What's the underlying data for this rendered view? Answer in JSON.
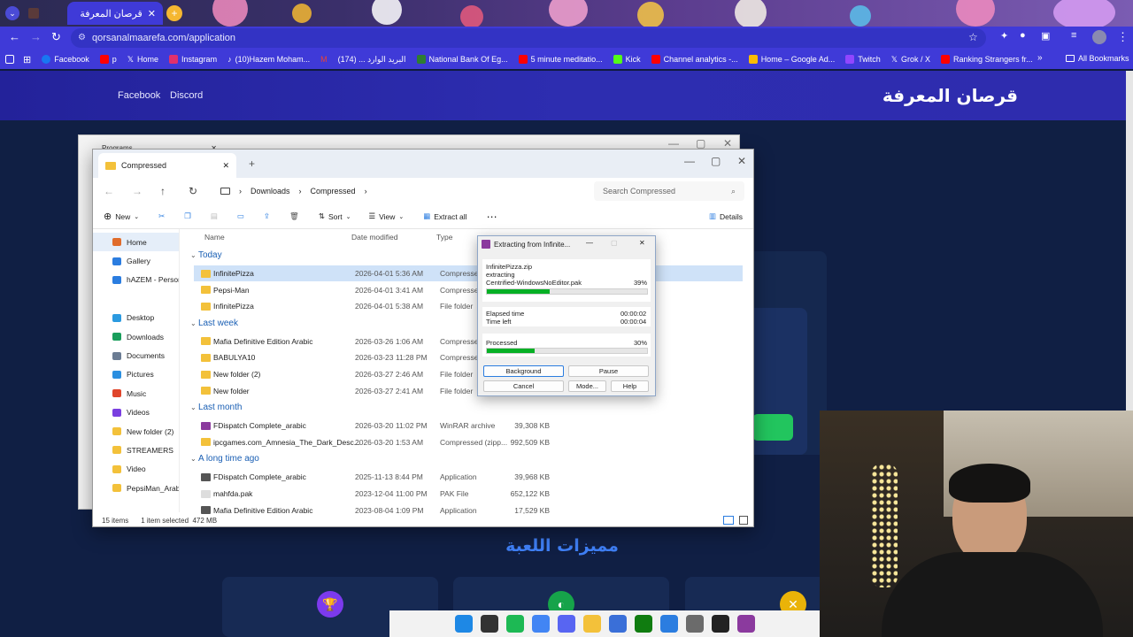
{
  "browser": {
    "tab_title": "قرصان المعرفة",
    "url": "qorsanalmaarefa.com/application",
    "bookmarks": [
      {
        "label": "Facebook",
        "color": "#1877f2"
      },
      {
        "label": "p",
        "color": "#ff0000"
      },
      {
        "label": "Home",
        "color": "#000000"
      },
      {
        "label": "Instagram",
        "color": "#e1306c"
      },
      {
        "label": "(10)Hazem Moham...",
        "color": "#111111"
      },
      {
        "label": "",
        "color": "#ea4335"
      },
      {
        "label": "(174) ... البريد الوارد",
        "color": "#ea4335"
      },
      {
        "label": "National Bank Of Eg...",
        "color": "#2e7d32"
      },
      {
        "label": "5 minute meditatio...",
        "color": "#ff0000"
      },
      {
        "label": "Kick",
        "color": "#53fc18"
      },
      {
        "label": "Channel analytics -...",
        "color": "#ff0000"
      },
      {
        "label": "Home – Google Ad...",
        "color": "#fbbc04"
      },
      {
        "label": "Twitch",
        "color": "#9146ff"
      },
      {
        "label": "Grok / X",
        "color": "#000000"
      },
      {
        "label": "Ranking Strangers fr...",
        "color": "#ff0000"
      }
    ],
    "all_bookmarks": "All Bookmarks"
  },
  "site": {
    "nav": {
      "facebook": "Facebook",
      "discord": "Discord"
    },
    "logo": "قرصان المعرفة",
    "features_title": "مميزات اللعبة"
  },
  "explorer_back": {
    "tab_title": "Programs"
  },
  "explorer": {
    "tab_title": "Compressed",
    "breadcrumb": [
      "Downloads",
      "Compressed"
    ],
    "search_placeholder": "Search Compressed",
    "commands": {
      "new": "New",
      "sort": "Sort",
      "view": "View",
      "extract_all": "Extract all",
      "details": "Details"
    },
    "nav": [
      {
        "label": "Home",
        "icon": "home-icon",
        "color": "#e06c2b"
      },
      {
        "label": "Gallery",
        "icon": "gallery-icon",
        "color": "#2b7de0"
      },
      {
        "label": "hAZEM - Persor",
        "icon": "cloud-icon",
        "color": "#2b7de0"
      },
      {
        "label": "",
        "icon": "",
        "color": ""
      },
      {
        "label": "Desktop",
        "icon": "desktop-icon",
        "color": "#2b9ae0"
      },
      {
        "label": "Downloads",
        "icon": "download-icon",
        "color": "#1a9e5c"
      },
      {
        "label": "Documents",
        "icon": "documents-icon",
        "color": "#6b7c93"
      },
      {
        "label": "Pictures",
        "icon": "pictures-icon",
        "color": "#2b8fe0"
      },
      {
        "label": "Music",
        "icon": "music-icon",
        "color": "#e0452b"
      },
      {
        "label": "Videos",
        "icon": "videos-icon",
        "color": "#7a3fe0"
      },
      {
        "label": "New folder (2)",
        "icon": "folder-icon",
        "color": "#f3c13a"
      },
      {
        "label": "STREAMERS",
        "icon": "folder-icon",
        "color": "#f3c13a"
      },
      {
        "label": "Video",
        "icon": "folder-icon",
        "color": "#f3c13a"
      },
      {
        "label": "PepsiMan_Arabi",
        "icon": "folder-icon",
        "color": "#f3c13a"
      }
    ],
    "columns": {
      "name": "Name",
      "date": "Date modified",
      "type": "Type",
      "size": "Size"
    },
    "groups": [
      {
        "title": "Today",
        "rows": [
          {
            "name": "InfinitePizza",
            "date": "2026-04-01 5:36 AM",
            "type": "Compressed",
            "size": "",
            "icon": "zip-folder-icon",
            "selected": true
          },
          {
            "name": "Pepsi-Man",
            "date": "2026-04-01 3:41 AM",
            "type": "Compressed",
            "size": "",
            "icon": "zip-folder-icon",
            "selected": false
          },
          {
            "name": "InfinitePizza",
            "date": "2026-04-01 5:38 AM",
            "type": "File folder",
            "size": "",
            "icon": "folder-icon",
            "selected": false
          }
        ]
      },
      {
        "title": "Last week",
        "rows": [
          {
            "name": "Mafia Definitive Edition Arabic",
            "date": "2026-03-26 1:06 AM",
            "type": "Compressed",
            "size": "",
            "icon": "zip-folder-icon",
            "selected": false
          },
          {
            "name": "BABULYA10",
            "date": "2026-03-23 11:28 PM",
            "type": "Compressed",
            "size": "",
            "icon": "zip-folder-icon",
            "selected": false
          },
          {
            "name": "New folder (2)",
            "date": "2026-03-27 2:46 AM",
            "type": "File folder",
            "size": "",
            "icon": "folder-icon",
            "selected": false
          },
          {
            "name": "New folder",
            "date": "2026-03-27 2:41 AM",
            "type": "File folder",
            "size": "",
            "icon": "folder-icon",
            "selected": false
          }
        ]
      },
      {
        "title": "Last month",
        "rows": [
          {
            "name": "FDispatch Complete_arabic",
            "date": "2026-03-20 11:02 PM",
            "type": "WinRAR archive",
            "size": "39,308 KB",
            "icon": "winrar-icon",
            "selected": false
          },
          {
            "name": "ipcgames.com_Amnesia_The_Dark_Desc...",
            "date": "2026-03-20 1:53 AM",
            "type": "Compressed (zipp...",
            "size": "992,509 KB",
            "icon": "zip-folder-icon",
            "selected": false
          }
        ]
      },
      {
        "title": "A long time ago",
        "rows": [
          {
            "name": "FDispatch Complete_arabic",
            "date": "2025-11-13 8:44 PM",
            "type": "Application",
            "size": "39,968 KB",
            "icon": "app-icon",
            "selected": false
          },
          {
            "name": "mahfda.pak",
            "date": "2023-12-04 11:00 PM",
            "type": "PAK File",
            "size": "652,122 KB",
            "icon": "file-icon",
            "selected": false
          },
          {
            "name": "Mafia Definitive Edition Arabic",
            "date": "2023-08-04 1:09 PM",
            "type": "Application",
            "size": "17,529 KB",
            "icon": "app-icon",
            "selected": false
          }
        ]
      }
    ],
    "status": {
      "items": "15 items",
      "selected": "1 item selected  472 MB"
    }
  },
  "winrar": {
    "title": "Extracting from Infinite...",
    "archive": "InfinitePizza.zip",
    "action": "extracting",
    "file": "Centrified-WindowsNoEditor.pak",
    "file_percent_label": "39%",
    "file_progress": 0.39,
    "elapsed_label": "Elapsed time",
    "elapsed_value": "00:00:02",
    "time_left_label": "Time left",
    "time_left_value": "00:00:04",
    "processed_label": "Processed",
    "processed_percent_label": "30%",
    "processed_progress": 0.3,
    "buttons": {
      "background": "Background",
      "pause": "Pause",
      "cancel": "Cancel",
      "mode": "Mode...",
      "help": "Help"
    }
  },
  "taskbar": [
    {
      "icon": "start-icon",
      "color": "#1e88e5"
    },
    {
      "icon": "app-red-icon",
      "color": "#333333"
    },
    {
      "icon": "spotify-icon",
      "color": "#1db954"
    },
    {
      "icon": "chrome-icon",
      "color": "#4285f4"
    },
    {
      "icon": "discord-icon",
      "color": "#5865f2"
    },
    {
      "icon": "explorer-icon",
      "color": "#f3c13a"
    },
    {
      "icon": "app-blue-icon",
      "color": "#3a6fd8"
    },
    {
      "icon": "xbox-icon",
      "color": "#107c10"
    },
    {
      "icon": "notepad-icon",
      "color": "#2b7de0"
    },
    {
      "icon": "settings-icon",
      "color": "#6b6b6b"
    },
    {
      "icon": "game-icon",
      "color": "#222222"
    },
    {
      "icon": "winrar-icon",
      "color": "#8b3a9e"
    }
  ]
}
